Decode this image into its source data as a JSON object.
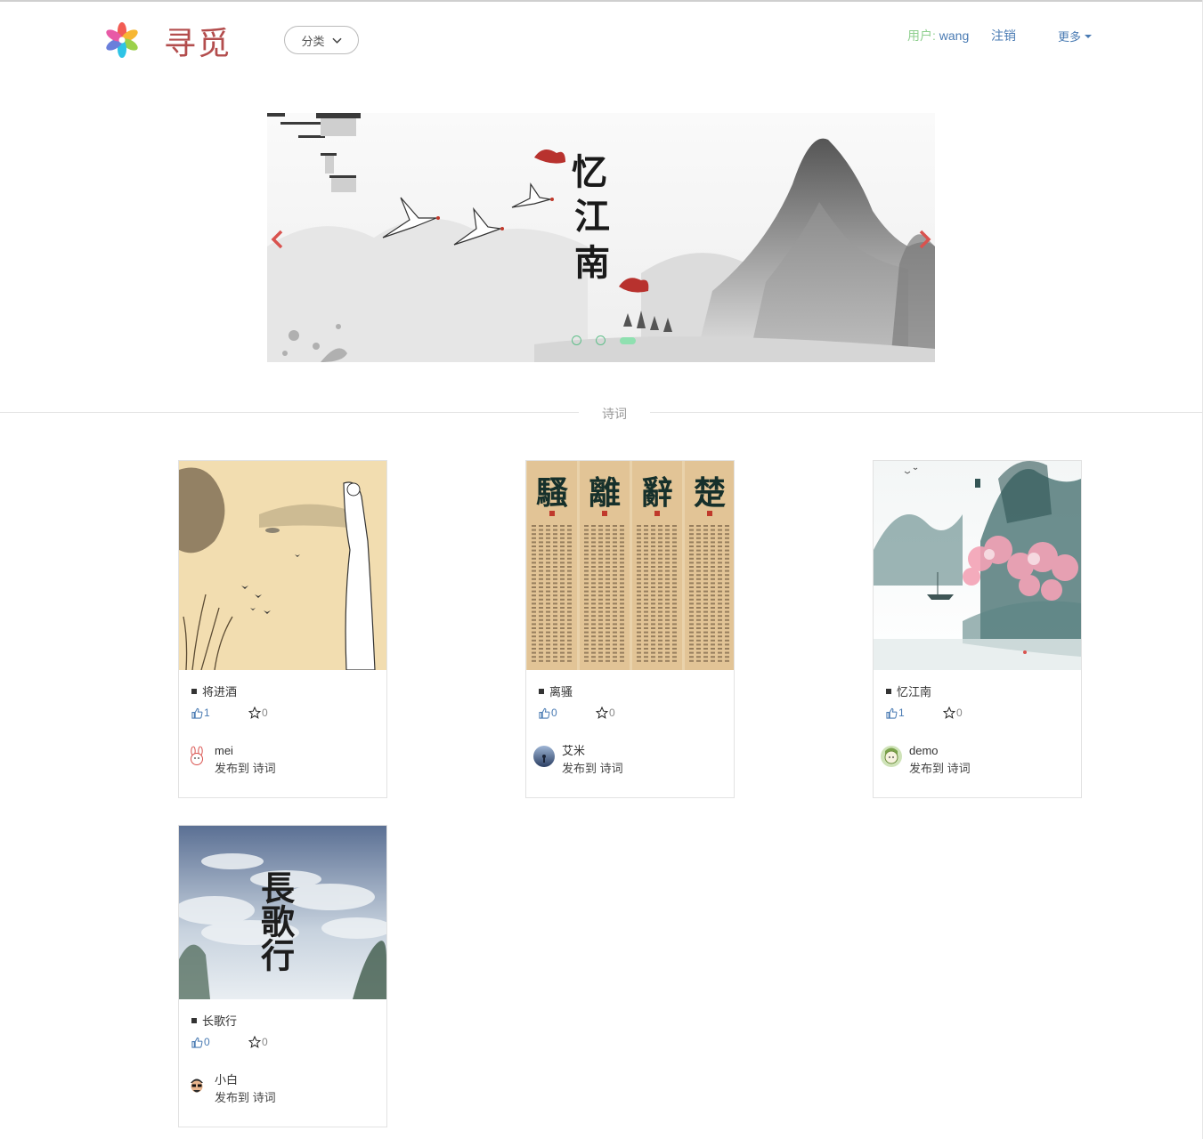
{
  "header": {
    "logo_text": "寻觅",
    "category_label": "分类",
    "user_label": "用户: ",
    "user_name": "wang",
    "logout_label": "注销",
    "more_label": "更多"
  },
  "carousel": {
    "slide_title": "忆江南",
    "slide_count": 3,
    "active_index": 2
  },
  "section": {
    "title": "诗词"
  },
  "colors": {
    "brand": "#b34d4d",
    "link": "#4a7bb3",
    "user_label": "#8fcf8f",
    "indicator": "#5fbf8a"
  },
  "posts": [
    {
      "title": "将进酒",
      "likes": "1",
      "favorites": "0",
      "author": "mei",
      "published_to": "发布到 诗词",
      "avatar_icon": "bunny-avatar-icon"
    },
    {
      "title": "离骚",
      "likes": "0",
      "favorites": "0",
      "author": "艾米",
      "published_to": "发布到 诗词",
      "avatar_icon": "landscape-avatar-icon"
    },
    {
      "title": "忆江南",
      "likes": "1",
      "favorites": "0",
      "author": "demo",
      "published_to": "发布到 诗词",
      "avatar_icon": "cartoon-avatar-icon"
    },
    {
      "title": "长歌行",
      "likes": "0",
      "favorites": "0",
      "author": "小白",
      "published_to": "发布到 诗词",
      "avatar_icon": "glasses-avatar-icon"
    }
  ],
  "thumb_text": {
    "lisao": [
      "騷",
      "離",
      "辭",
      "楚"
    ],
    "changgexing": "長歌行"
  }
}
